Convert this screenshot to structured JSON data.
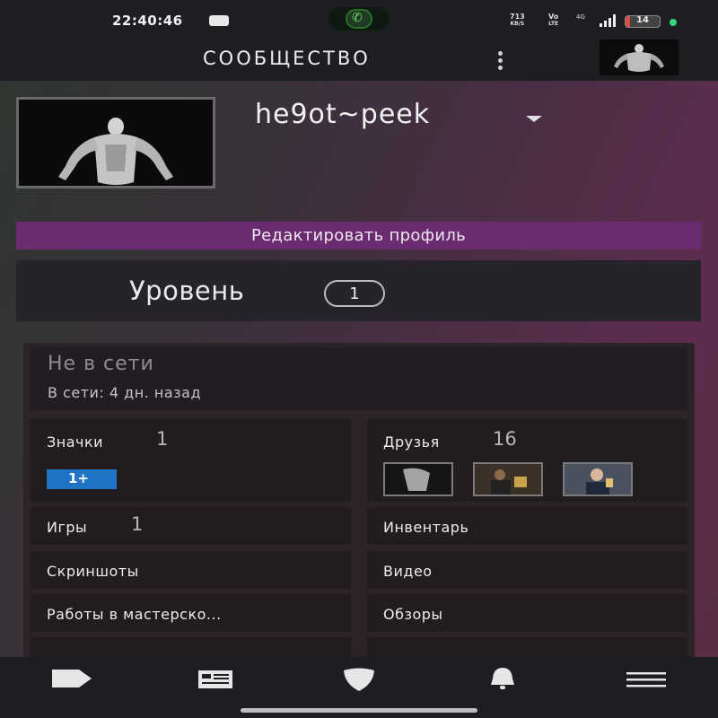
{
  "status_bar": {
    "time": "22:40:46",
    "speed": "713",
    "speed_unit": "KB/S",
    "volte_top": "Vo",
    "volte_bottom": "LTE",
    "network": "4G",
    "battery": "14",
    "battery_level": 0.14
  },
  "app_bar": {
    "title": "СООБЩЕСТВО",
    "menu_icon": "more-vertical-icon"
  },
  "profile": {
    "username": "he9ot~peek",
    "edit_button": "Редактировать профиль",
    "level_label": "Уровень",
    "level_value": "1",
    "status_title": "Не в сети",
    "status_sub": "В сети: 4 дн. назад"
  },
  "tiles": {
    "badges": {
      "label": "Значки",
      "count": "1",
      "badge_text": "1+"
    },
    "friends": {
      "label": "Друзья",
      "count": "16"
    },
    "games": {
      "label": "Игры",
      "count": "1"
    },
    "inventory": {
      "label": "Инвентарь"
    },
    "screenshots": {
      "label": "Скриншоты"
    },
    "videos": {
      "label": "Видео"
    },
    "workshop": {
      "label": "Работы в мастерско..."
    },
    "reviews": {
      "label": "Обзоры"
    }
  },
  "bottom_nav": [
    {
      "icon": "store-tag-icon"
    },
    {
      "icon": "news-icon"
    },
    {
      "icon": "shield-icon"
    },
    {
      "icon": "bell-icon"
    },
    {
      "icon": "hamburger-menu-icon"
    }
  ],
  "colors": {
    "accent_purple": "#6a2b70",
    "bar_bg": "#1d1e22",
    "tile_bg": "#211c20"
  }
}
